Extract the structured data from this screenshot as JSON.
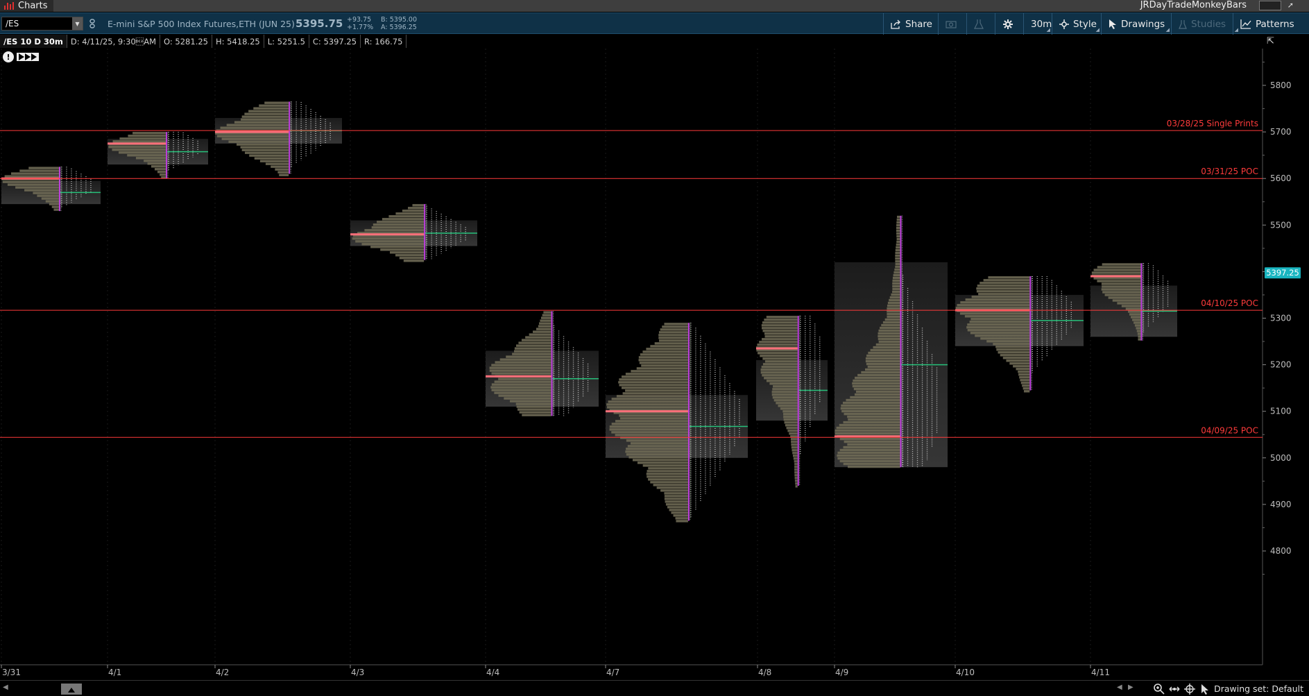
{
  "app": {
    "title": "Charts",
    "workspace": "JRDayTradeMonkeyBars"
  },
  "header": {
    "symbol": "/ES",
    "description": "E-mini S&P 500 Index Futures,ETH (JUN 25)",
    "last": "5395.75",
    "net_change": "+93.75",
    "pct_change": "+1.77%",
    "bid": "B: 5395.00",
    "ask": "A: 5396.25",
    "tools": {
      "share": "Share",
      "timeframe": "30m",
      "style": "Style",
      "drawings": "Drawings",
      "studies": "Studies",
      "patterns": "Patterns"
    }
  },
  "info_row": {
    "chart_label": "/ES 10 D 30m",
    "date": "D: 4/11/25, 9:30\u0013AM",
    "open": "O: 5281.25",
    "high": "H: 5418.25",
    "low": "L: 5251.5",
    "close": "C: 5397.25",
    "range": "R: 166.75"
  },
  "chart_data": {
    "type": "volume-profile",
    "y_ticks": [
      5800,
      5700,
      5600,
      5500,
      5400,
      5300,
      5200,
      5100,
      5000,
      4900,
      4800
    ],
    "ylim": [
      4770,
      5840
    ],
    "x_labels": [
      "3/31",
      "4/1",
      "4/2",
      "4/3",
      "4/4",
      "4/7",
      "4/8",
      "4/9",
      "4/10",
      "4/11"
    ],
    "current_price_label": "5397.25",
    "current_price": 5397.25,
    "reference_lines": [
      {
        "price": 5703,
        "label": "03/28/25  Single Prints"
      },
      {
        "price": 5600,
        "label": "03/31/25  POC"
      },
      {
        "price": 5317,
        "label": "04/10/25  POC"
      },
      {
        "price": 5044,
        "label": "04/09/25  POC"
      }
    ],
    "sessions": [
      {
        "date": "3/31",
        "high": 5625,
        "low": 5530,
        "poc": 5600,
        "va_high": 5595,
        "va_low": 5545
      },
      {
        "date": "4/1",
        "high": 5700,
        "low": 5600,
        "poc": 5675,
        "va_high": 5685,
        "va_low": 5630
      },
      {
        "date": "4/2",
        "high": 5765,
        "low": 5610,
        "poc": 5700,
        "va_high": 5730,
        "va_low": 5675
      },
      {
        "date": "4/3",
        "high": 5545,
        "low": 5425,
        "poc": 5480,
        "va_high": 5510,
        "va_low": 5455
      },
      {
        "date": "4/4",
        "high": 5315,
        "low": 5090,
        "poc": 5175,
        "va_high": 5230,
        "va_low": 5110
      },
      {
        "date": "4/7",
        "high": 5290,
        "low": 4865,
        "poc": 5100,
        "va_high": 5135,
        "va_low": 5000
      },
      {
        "date": "4/8",
        "high": 5305,
        "low": 4940,
        "poc": 5235,
        "va_high": 5210,
        "va_low": 5080
      },
      {
        "date": "4/9",
        "high": 5520,
        "low": 4980,
        "poc": 5046,
        "va_high": 5420,
        "va_low": 4980
      },
      {
        "date": "4/10",
        "high": 5390,
        "low": 5145,
        "poc": 5317,
        "va_high": 5350,
        "va_low": 5240
      },
      {
        "date": "4/11",
        "high": 5418,
        "low": 5252,
        "poc": 5390,
        "va_high": 5370,
        "va_low": 5260
      }
    ]
  },
  "footer": {
    "drawing_set": "Drawing set: Default"
  },
  "colors": {
    "ref_line": "#ff3b3b",
    "poc": "#ff6f7a",
    "profile": "#6f6a55",
    "value_area": "#2b2b2b",
    "tpo": "#e8e8e8",
    "marker": "#c040e0",
    "green": "#27c07a",
    "price_badge": "#19b5c0"
  }
}
